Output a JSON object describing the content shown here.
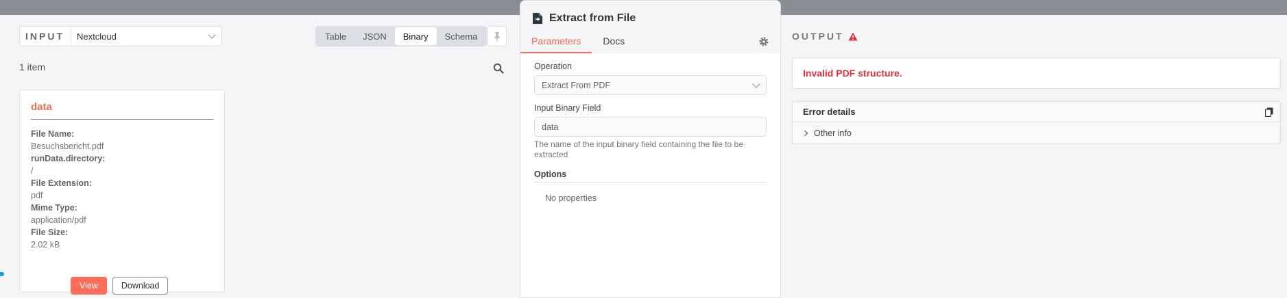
{
  "input": {
    "title": "INPUT",
    "source_value": "Nextcloud",
    "view_tabs": [
      "Table",
      "JSON",
      "Binary",
      "Schema"
    ],
    "active_tab": "Binary",
    "item_count": "1 item",
    "card": {
      "title": "data",
      "fields": [
        {
          "label": "File Name:",
          "value": "Besuchsbericht.pdf"
        },
        {
          "label": "runData.directory:",
          "value": "/"
        },
        {
          "label": "File Extension:",
          "value": "pdf"
        },
        {
          "label": "Mime Type:",
          "value": "application/pdf"
        },
        {
          "label": "File Size:",
          "value": "2.02 kB"
        }
      ],
      "view_label": "View",
      "download_label": "Download"
    }
  },
  "node": {
    "title": "Extract from File",
    "tabs": [
      "Parameters",
      "Docs"
    ],
    "operation_label": "Operation",
    "operation_value": "Extract From PDF",
    "binary_field_label": "Input Binary Field",
    "binary_field_value": "data",
    "binary_field_hint": "The name of the input binary field containing the file to be extracted",
    "options_label": "Options",
    "no_properties": "No properties"
  },
  "output": {
    "title": "OUTPUT",
    "error_message": "Invalid PDF structure.",
    "details_title": "Error details",
    "other_info": "Other info"
  },
  "colors": {
    "accent": "#ff6d5a",
    "error": "#e0303a"
  }
}
